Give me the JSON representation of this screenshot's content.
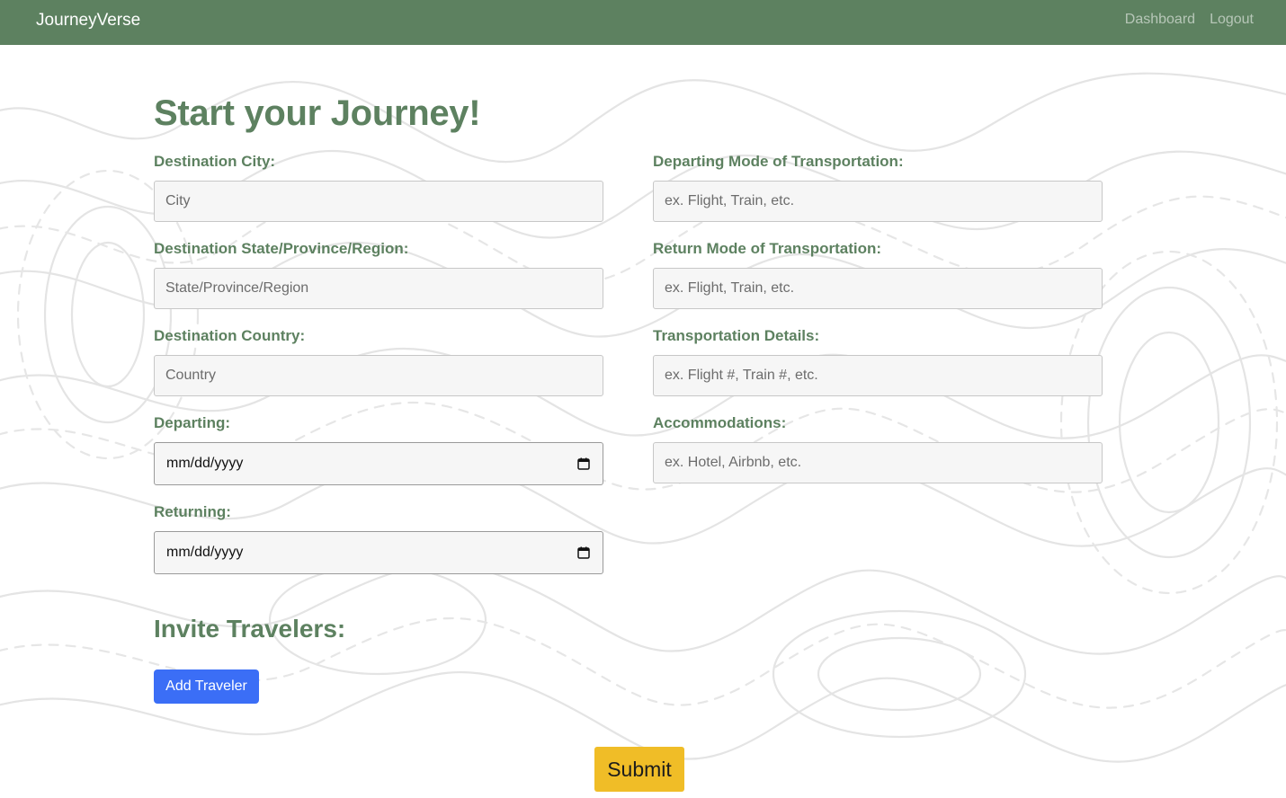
{
  "navbar": {
    "brand": "JourneyVerse",
    "links": [
      "Dashboard",
      "Logout"
    ]
  },
  "page": {
    "title": "Start your Journey!"
  },
  "form": {
    "city": {
      "label": "Destination City:",
      "placeholder": "City"
    },
    "state": {
      "label": "Destination State/Province/Region:",
      "placeholder": "State/Province/Region"
    },
    "country": {
      "label": "Destination Country:",
      "placeholder": "Country"
    },
    "departing": {
      "label": "Departing:",
      "value": "mm/dd/yyyy"
    },
    "returning": {
      "label": "Returning:",
      "value": "mm/dd/yyyy"
    },
    "departing_transport": {
      "label": "Departing Mode of Transportation:",
      "placeholder": "ex. Flight, Train, etc."
    },
    "return_transport": {
      "label": "Return Mode of Transportation:",
      "placeholder": "ex. Flight, Train, etc."
    },
    "transport_details": {
      "label": "Transportation Details:",
      "placeholder": "ex. Flight #, Train #, etc."
    },
    "accommodations": {
      "label": "Accommodations:",
      "placeholder": "ex. Hotel, Airbnb, etc."
    }
  },
  "invite": {
    "title": "Invite Travelers:",
    "add_button": "Add Traveler"
  },
  "submit_label": "Submit",
  "colors": {
    "brand_green": "#5d8160",
    "add_button_blue": "#3b6ef6",
    "submit_yellow": "#f0bd27",
    "field_bg": "#f6f6f6"
  },
  "icons": {
    "date_picker": "calendar-icon",
    "background": "topographic-pattern"
  }
}
